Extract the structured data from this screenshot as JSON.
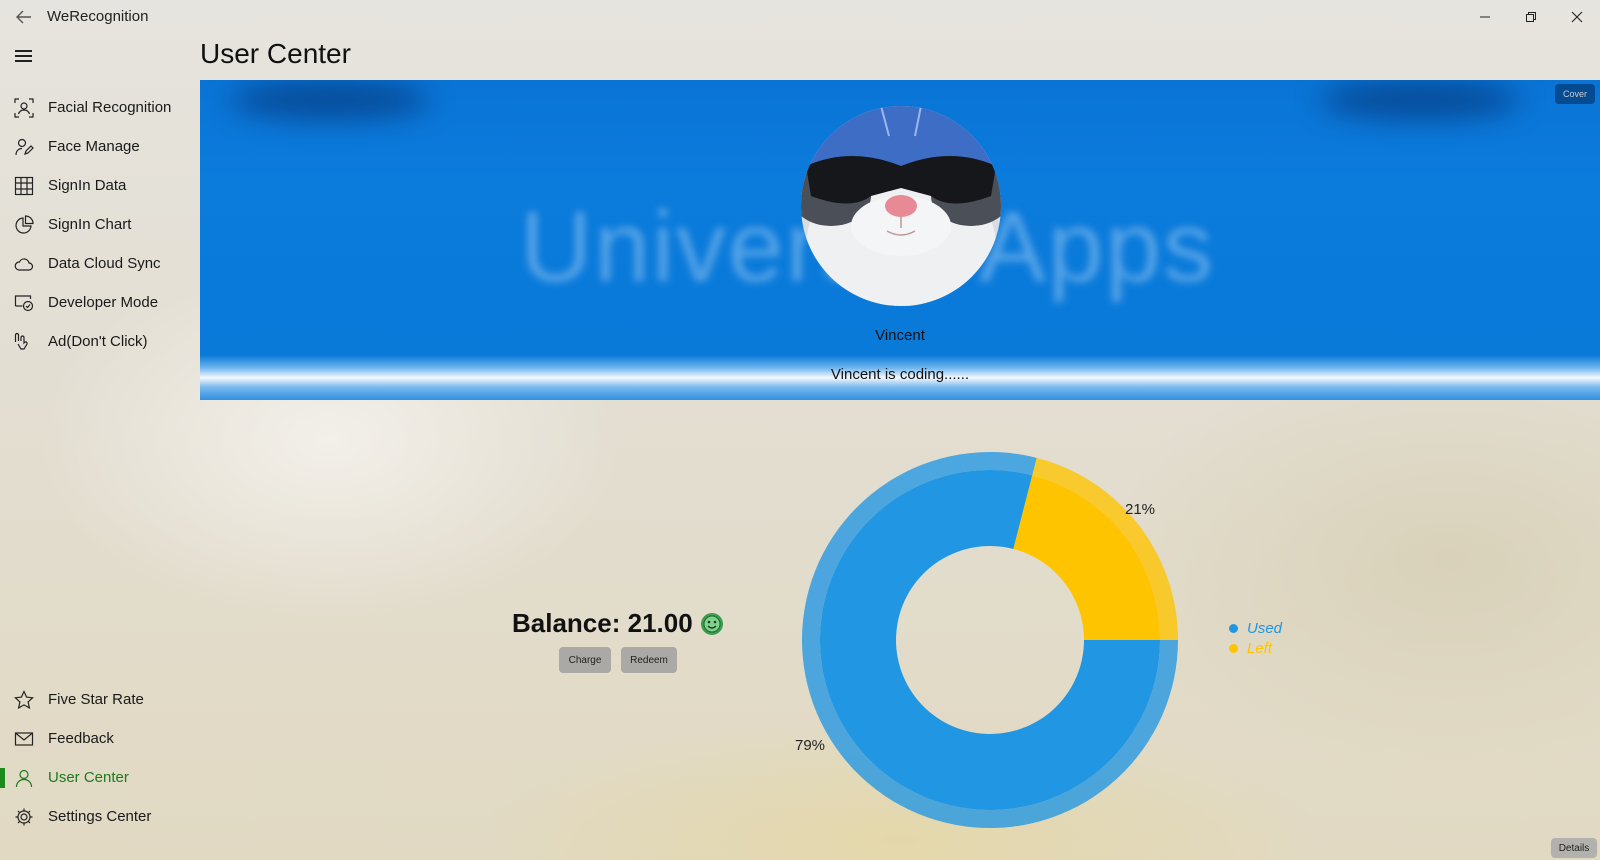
{
  "window": {
    "title": "WeRecognition"
  },
  "nav": {
    "items": [
      {
        "label": "Facial Recognition",
        "icon": "face-scan-icon"
      },
      {
        "label": "Face Manage",
        "icon": "person-edit-icon"
      },
      {
        "label": "SignIn Data",
        "icon": "grid-icon"
      },
      {
        "label": "SignIn Chart",
        "icon": "pie-chart-icon"
      },
      {
        "label": "Data Cloud Sync",
        "icon": "cloud-icon"
      },
      {
        "label": "Developer Mode",
        "icon": "developer-icon"
      },
      {
        "label": "Ad(Don't Click)",
        "icon": "hand-pointer-icon"
      }
    ],
    "footer_items": [
      {
        "label": "Five Star Rate",
        "icon": "star-icon"
      },
      {
        "label": "Feedback",
        "icon": "mail-icon"
      },
      {
        "label": "User Center",
        "icon": "person-icon",
        "active": true
      },
      {
        "label": "Settings Center",
        "icon": "gear-icon"
      }
    ],
    "active_color": "#1d7a1d"
  },
  "page": {
    "title": "User Center"
  },
  "banner": {
    "watermark": "Universal Apps",
    "cover_label": "Cover",
    "user_name": "Vincent",
    "status": "Vincent is coding......",
    "background_color": "#0b7bdc"
  },
  "account": {
    "balance_text": "Balance: 21.00",
    "charge_label": "Charge",
    "redeem_label": "Redeem"
  },
  "chart_data": {
    "type": "pie",
    "donut": true,
    "slices": [
      {
        "name": "Used",
        "value": 79,
        "label": "79%",
        "color": "#2196e3"
      },
      {
        "name": "Left",
        "value": 21,
        "label": "21%",
        "color": "#ffc400"
      }
    ],
    "legend_position": "right"
  },
  "details_label": "Details"
}
